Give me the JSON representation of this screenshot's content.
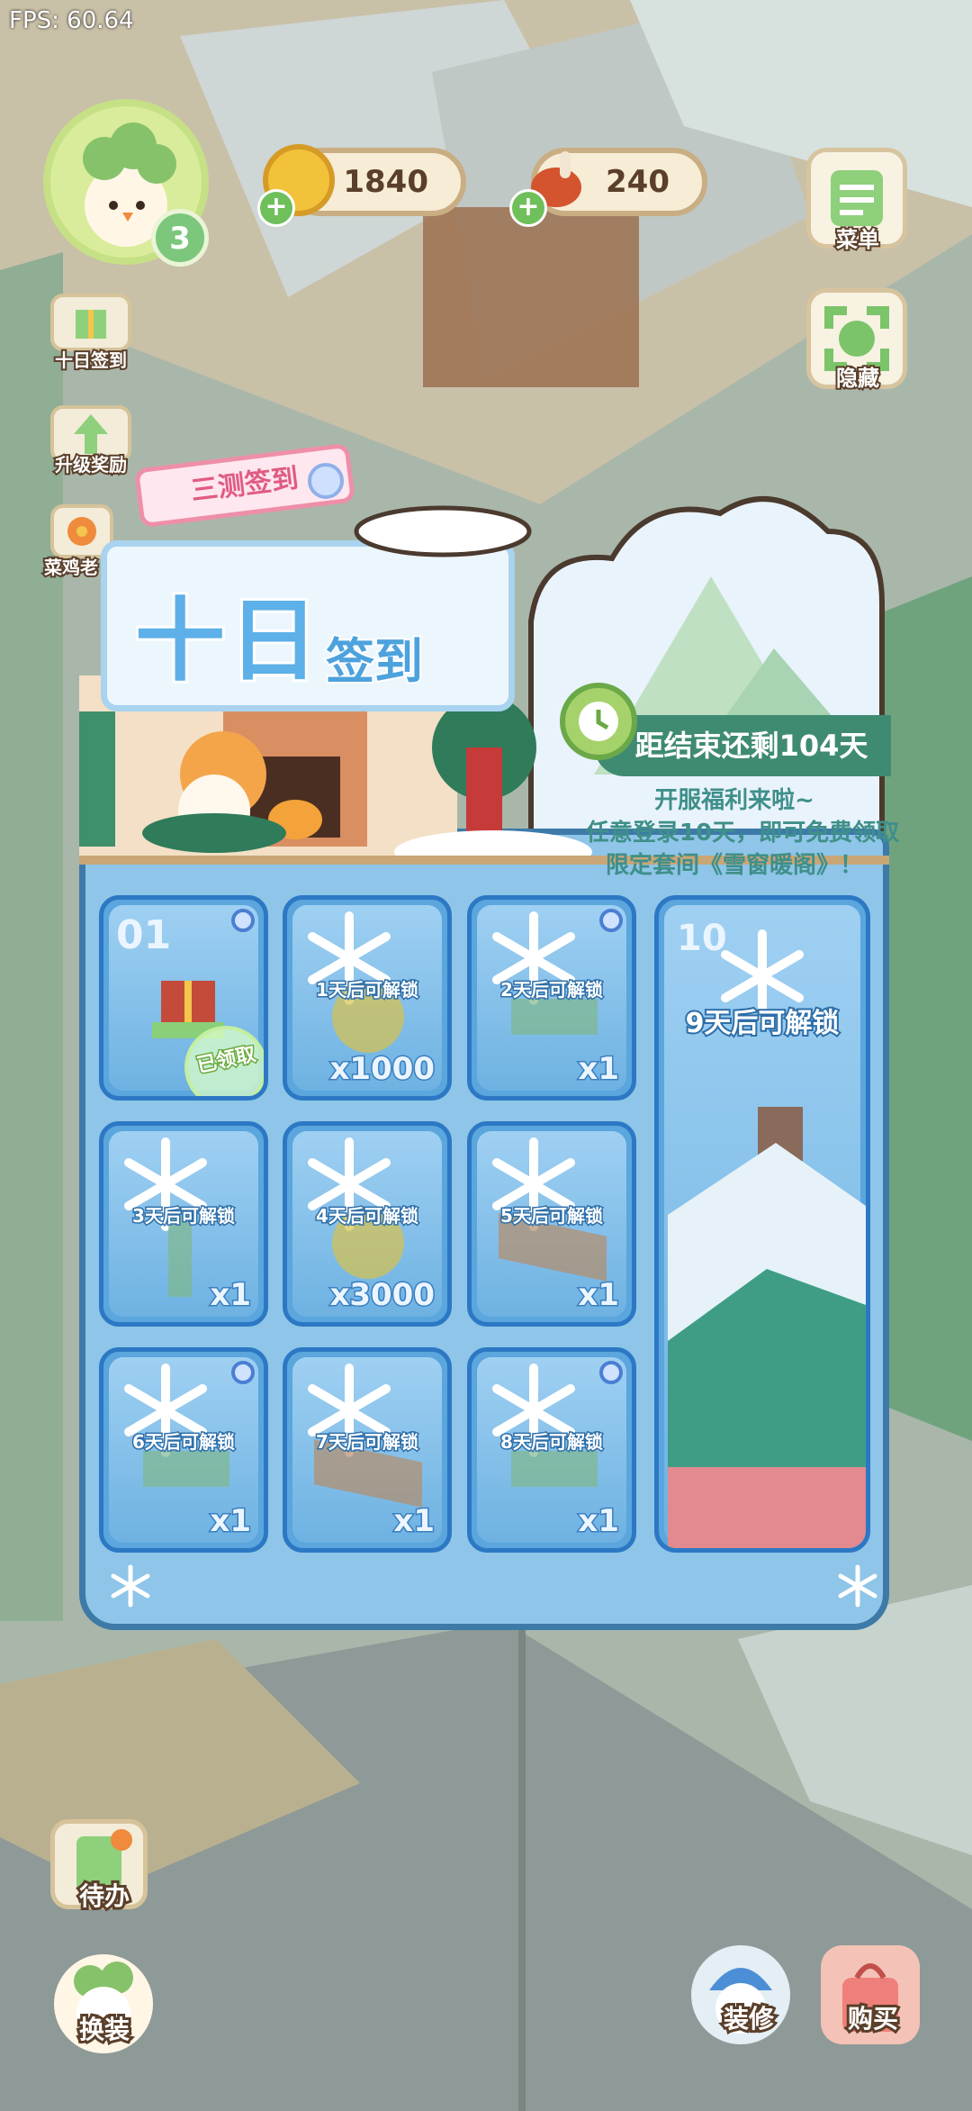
{
  "hud": {
    "fps": "FPS: 60.64",
    "level": "3",
    "coins": "1840",
    "food": "240"
  },
  "right_menu": {
    "menu_label": "菜单",
    "hide_label": "隐藏"
  },
  "left_menu": {
    "checkin_label": "十日签到",
    "upgrade_label": "升级奖励",
    "third_label": "菜鸡老"
  },
  "panel": {
    "tag": "三测签到",
    "title_main": "十日",
    "title_sub": "签到",
    "timer": "距结束还剩104天",
    "info_line1": "开服福利来啦~",
    "info_line2": "任意登录10天，即可免费领取",
    "info_line3": "限定套间《雪窗暖阁》！",
    "claimed_label": "已领取",
    "cells": [
      {
        "day": "01",
        "lock": "",
        "qty": "",
        "claimed": true
      },
      {
        "day": "",
        "lock": "1天后可解锁",
        "qty": "x1000",
        "claimed": false
      },
      {
        "day": "",
        "lock": "2天后可解锁",
        "qty": "x1",
        "claimed": false
      },
      {
        "day": "",
        "lock": "3天后可解锁",
        "qty": "x1",
        "claimed": false
      },
      {
        "day": "",
        "lock": "4天后可解锁",
        "qty": "x3000",
        "claimed": false
      },
      {
        "day": "",
        "lock": "5天后可解锁",
        "qty": "x1",
        "claimed": false
      },
      {
        "day": "",
        "lock": "6天后可解锁",
        "qty": "x1",
        "claimed": false
      },
      {
        "day": "",
        "lock": "7天后可解锁",
        "qty": "x1",
        "claimed": false
      },
      {
        "day": "",
        "lock": "8天后可解锁",
        "qty": "x1",
        "claimed": false
      }
    ],
    "big_cell": {
      "day": "10",
      "lock": "9天后可解锁"
    }
  },
  "bottom": {
    "todo_label": "待办",
    "dress_label": "换装",
    "decorate_label": "装修",
    "buy_label": "购买"
  },
  "colors": {
    "panel_blue": "#8ec5e8",
    "cell_border": "#2c78c4",
    "timer_green": "#3f8b72",
    "coin_gold": "#f2c23a"
  }
}
